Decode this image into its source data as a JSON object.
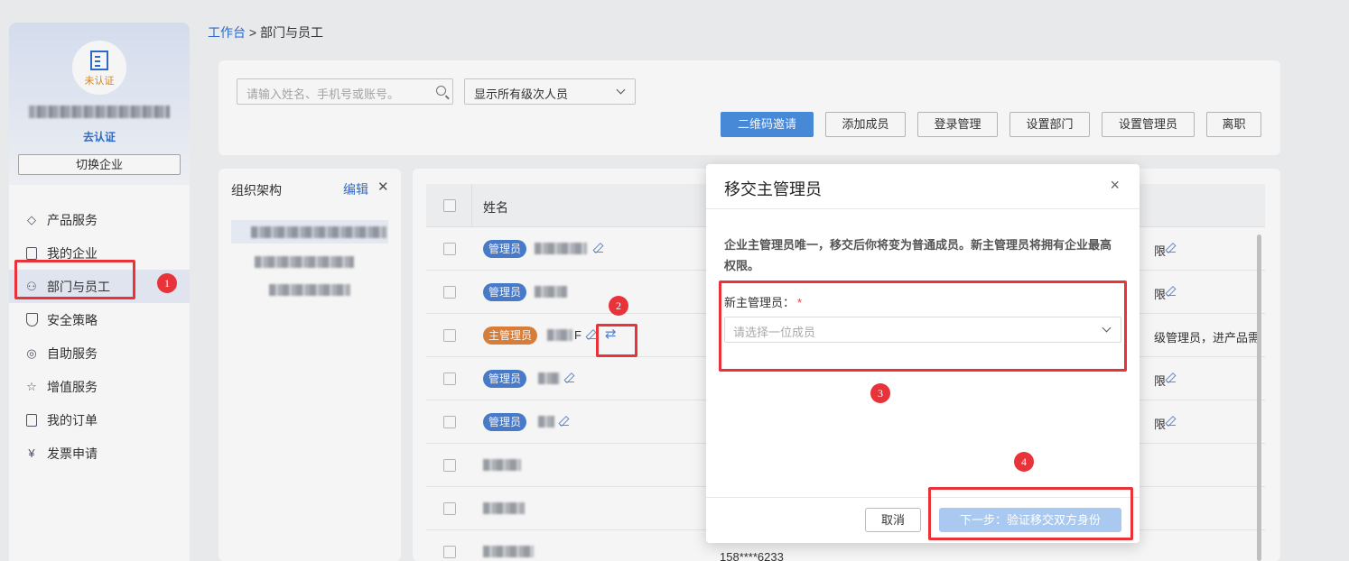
{
  "sidebar": {
    "org_status": "未认证",
    "go_verify": "去认证",
    "switch_company": "切换企业",
    "items": [
      {
        "label": "产品服务",
        "icon": "layers-icon"
      },
      {
        "label": "我的企业",
        "icon": "document-icon"
      },
      {
        "label": "部门与员工",
        "icon": "users-icon"
      },
      {
        "label": "安全策略",
        "icon": "shield-icon"
      },
      {
        "label": "自助服务",
        "icon": "target-icon"
      },
      {
        "label": "增值服务",
        "icon": "star-icon"
      },
      {
        "label": "我的订单",
        "icon": "list-icon"
      },
      {
        "label": "发票申请",
        "icon": "yen-icon"
      }
    ]
  },
  "breadcrumb": {
    "root": "工作台",
    "sep": ">",
    "current": "部门与员工"
  },
  "toolbar": {
    "search_placeholder": "请输入姓名、手机号或账号。",
    "level_select": "显示所有级次人员",
    "buttons": [
      "二维码邀请",
      "添加成员",
      "登录管理",
      "设置部门",
      "设置管理员",
      "离职"
    ]
  },
  "org_panel": {
    "title": "组织架构",
    "edit": "编辑",
    "close": "✕"
  },
  "table": {
    "header_name": "姓名",
    "rows": [
      {
        "badge": "管理员",
        "right": "限"
      },
      {
        "badge": "管理员",
        "right": "限"
      },
      {
        "badge": "主管理员",
        "suffix": "F",
        "right": "级管理员，进产品需"
      },
      {
        "badge": "管理员",
        "right": "限"
      },
      {
        "badge": "管理员",
        "right": "限"
      }
    ],
    "bottom_phone": "158****6233"
  },
  "modal": {
    "title": "移交主管理员",
    "close": "×",
    "description": "企业主管理员唯一，移交后你将变为普通成员。新主管理员将拥有企业最高权限。",
    "field_label": "新主管理员：",
    "required_mark": "*",
    "select_placeholder": "请选择一位成员",
    "cancel": "取消",
    "next": "下一步：验证移交双方身份"
  },
  "annotations": [
    "1",
    "2",
    "3",
    "4"
  ],
  "colors": {
    "accent": "#2f6fd1",
    "primary_button": "#4a8ee0",
    "annotation": "#e8333a",
    "owner_badge": "#e0833a"
  }
}
